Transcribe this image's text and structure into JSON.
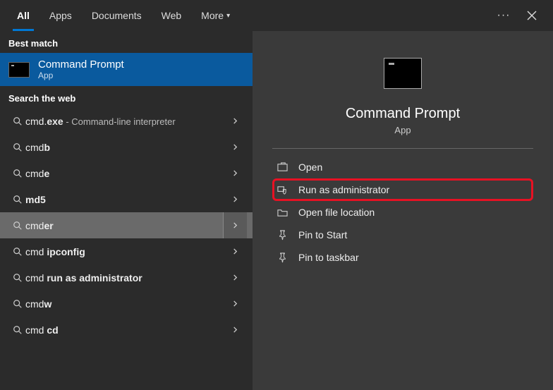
{
  "tabs": {
    "all": "All",
    "apps": "Apps",
    "documents": "Documents",
    "web": "Web",
    "more": "More"
  },
  "sections": {
    "best_match": "Best match",
    "search_web": "Search the web"
  },
  "best_match": {
    "title": "Command Prompt",
    "subtitle": "App"
  },
  "web_results": [
    {
      "prefix": "cmd.",
      "bold": "exe",
      "tail": " - Command-line interpreter",
      "highlighted": false
    },
    {
      "prefix": "cmd",
      "bold": "b",
      "tail": "",
      "highlighted": false
    },
    {
      "prefix": "cmd",
      "bold": "e",
      "tail": "",
      "highlighted": false
    },
    {
      "prefix": "",
      "bold": "md5",
      "tail": "",
      "highlighted": false
    },
    {
      "prefix": "cmd",
      "bold": "er",
      "tail": "",
      "highlighted": true
    },
    {
      "prefix": "cmd ",
      "bold": "ipconfig",
      "tail": "",
      "highlighted": false
    },
    {
      "prefix": "cmd ",
      "bold": "run as administrator",
      "tail": "",
      "highlighted": false
    },
    {
      "prefix": "cmd",
      "bold": "w",
      "tail": "",
      "highlighted": false
    },
    {
      "prefix": "cmd ",
      "bold": "cd",
      "tail": "",
      "highlighted": false
    }
  ],
  "detail": {
    "title": "Command Prompt",
    "subtitle": "App"
  },
  "actions": {
    "open": "Open",
    "run_admin": "Run as administrator",
    "open_loc": "Open file location",
    "pin_start": "Pin to Start",
    "pin_taskbar": "Pin to taskbar"
  }
}
